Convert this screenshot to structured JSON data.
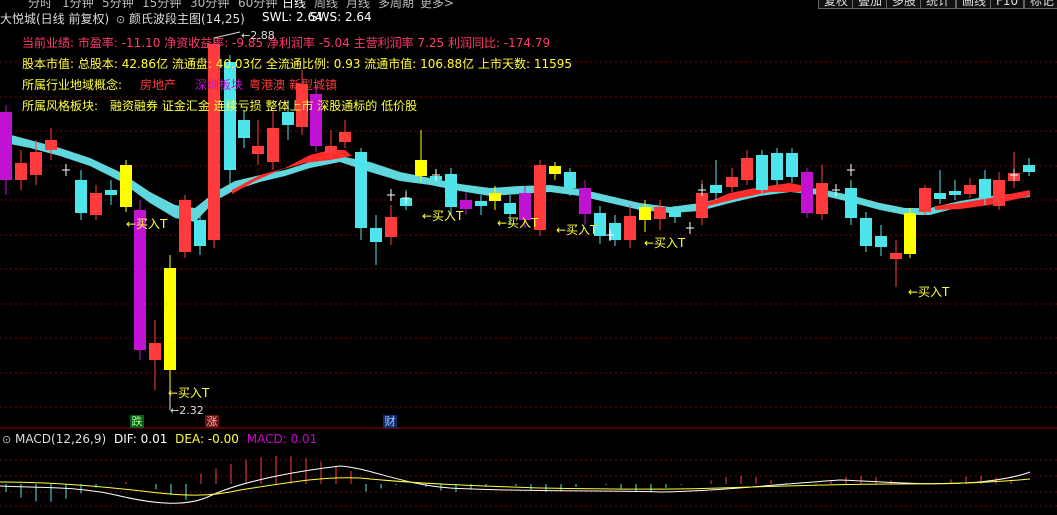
{
  "top_tabs": [
    "分时",
    "1分钟",
    "5分钟",
    "15分钟",
    "30分钟",
    "60分钟",
    "日线",
    "周线",
    "月线",
    "多周期",
    "更多>"
  ],
  "top_right_buttons": [
    "复权",
    "叠加",
    "多股",
    "统计",
    "画线",
    "F10",
    "标记"
  ],
  "header": {
    "stock": "大悦城(日线 前复权)",
    "indicator": "颜氏波段主图(14,25)",
    "swl": "SWL: 2.64",
    "sws": "SWS: 2.64"
  },
  "info": {
    "line1": "当前业绩: 市盈率: -11.10 净资收益率: -9.85 净利润率 -5.04 主营利润率 7.25 利润同比: -174.79",
    "line2": "股本市值: 总股本: 42.86亿 流通盘: 40.03亿 全流通比例: 0.93 流通市值: 106.88亿 上市天数: 11595",
    "line3_label": "所属行业地域概念:",
    "line3_tags": [
      "房地产",
      "深圳板块",
      "粤港澳",
      "新型城镇"
    ],
    "line4_label": "所属风格板块:",
    "line4_text": "融资融券 证金汇金 连续亏损 整体上市 深股通标的 低价股"
  },
  "markers": {
    "high_price": "2.88",
    "low_price": "2.32",
    "buy_label": "←买入T",
    "badge_fall": "跌",
    "badge_rise": "涨",
    "badge_finance": "财"
  },
  "macd": {
    "label": "MACD(12,26,9)",
    "dif": "DIF: 0.01",
    "dea": "DEA: -0.00",
    "macd": "MACD: 0.01"
  },
  "colors": {
    "up": "#ff3b3b",
    "down": "#4ee4ec",
    "signal_purple": "#c112d4",
    "signal_yellow": "#ffff00",
    "ribbon_cyan": "#5fd7dd",
    "ribbon_red": "#ff2b2b",
    "grid": "#7a0000",
    "separator": "#9b0000"
  }
}
